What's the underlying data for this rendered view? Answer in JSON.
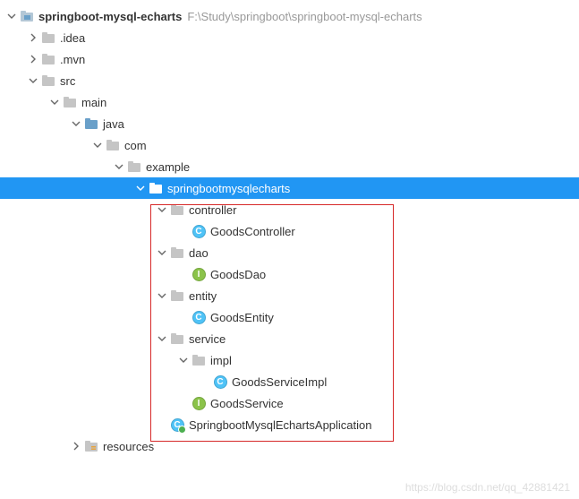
{
  "root": {
    "name": "springboot-mysql-echarts",
    "path": "F:\\Study\\springboot\\springboot-mysql-echarts"
  },
  "nodes": {
    "idea": ".idea",
    "mvn": ".mvn",
    "src": "src",
    "main": "main",
    "java": "java",
    "com": "com",
    "example": "example",
    "pkg": "springbootmysqlecharts",
    "controller": "controller",
    "goodsController": "GoodsController",
    "dao": "dao",
    "goodsDao": "GoodsDao",
    "entity": "entity",
    "goodsEntity": "GoodsEntity",
    "service": "service",
    "impl": "impl",
    "goodsServiceImpl": "GoodsServiceImpl",
    "goodsService": "GoodsService",
    "appClass": "SpringbootMysqlEchartsApplication",
    "resources": "resources"
  },
  "watermark": "https://blog.csdn.net/qq_42881421"
}
